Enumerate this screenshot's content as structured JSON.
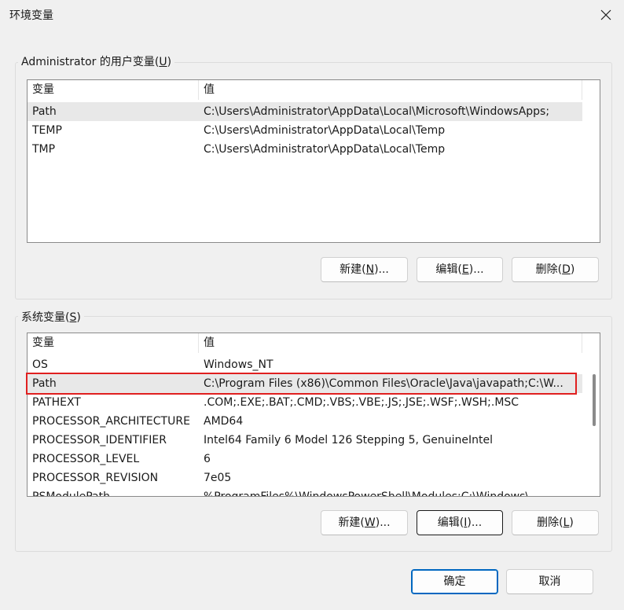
{
  "window": {
    "title": "环境变量"
  },
  "user_section": {
    "legend_prefix": "Administrator 的用户变量(",
    "legend_key": "U",
    "legend_suffix": ")",
    "columns": [
      "变量",
      "值"
    ],
    "rows": [
      {
        "name": "Path",
        "value": "C:\\Users\\Administrator\\AppData\\Local\\Microsoft\\WindowsApps;"
      },
      {
        "name": "TEMP",
        "value": "C:\\Users\\Administrator\\AppData\\Local\\Temp"
      },
      {
        "name": "TMP",
        "value": "C:\\Users\\Administrator\\AppData\\Local\\Temp"
      }
    ],
    "buttons": {
      "new": {
        "prefix": "新建(",
        "key": "N",
        "suffix": ")..."
      },
      "edit": {
        "prefix": "编辑(",
        "key": "E",
        "suffix": ")..."
      },
      "delete": {
        "prefix": "删除(",
        "key": "D",
        "suffix": ")"
      }
    }
  },
  "system_section": {
    "legend_prefix": "系统变量(",
    "legend_key": "S",
    "legend_suffix": ")",
    "columns": [
      "变量",
      "值"
    ],
    "rows": [
      {
        "name": "OS",
        "value": "Windows_NT"
      },
      {
        "name": "Path",
        "value": "C:\\Program Files (x86)\\Common Files\\Oracle\\Java\\javapath;C:\\W..."
      },
      {
        "name": "PATHEXT",
        "value": ".COM;.EXE;.BAT;.CMD;.VBS;.VBE;.JS;.JSE;.WSF;.WSH;.MSC"
      },
      {
        "name": "PROCESSOR_ARCHITECTURE",
        "value": "AMD64"
      },
      {
        "name": "PROCESSOR_IDENTIFIER",
        "value": "Intel64 Family 6 Model 126 Stepping 5, GenuineIntel"
      },
      {
        "name": "PROCESSOR_LEVEL",
        "value": "6"
      },
      {
        "name": "PROCESSOR_REVISION",
        "value": "7e05"
      },
      {
        "name": "PSModulePath",
        "value": "%ProgramFiles%\\WindowsPowerShell\\Modules;C:\\Windows\\..."
      }
    ],
    "buttons": {
      "new": {
        "prefix": "新建(",
        "key": "W",
        "suffix": ")..."
      },
      "edit": {
        "prefix": "编辑(",
        "key": "I",
        "suffix": ")..."
      },
      "delete": {
        "prefix": "删除(",
        "key": "L",
        "suffix": ")"
      }
    }
  },
  "footer": {
    "ok_label": "确定",
    "cancel_label": "取消"
  },
  "colors": {
    "highlight": "#e02020",
    "default_button_border": "#0067c0",
    "selected_row": "#e8e8e8"
  }
}
